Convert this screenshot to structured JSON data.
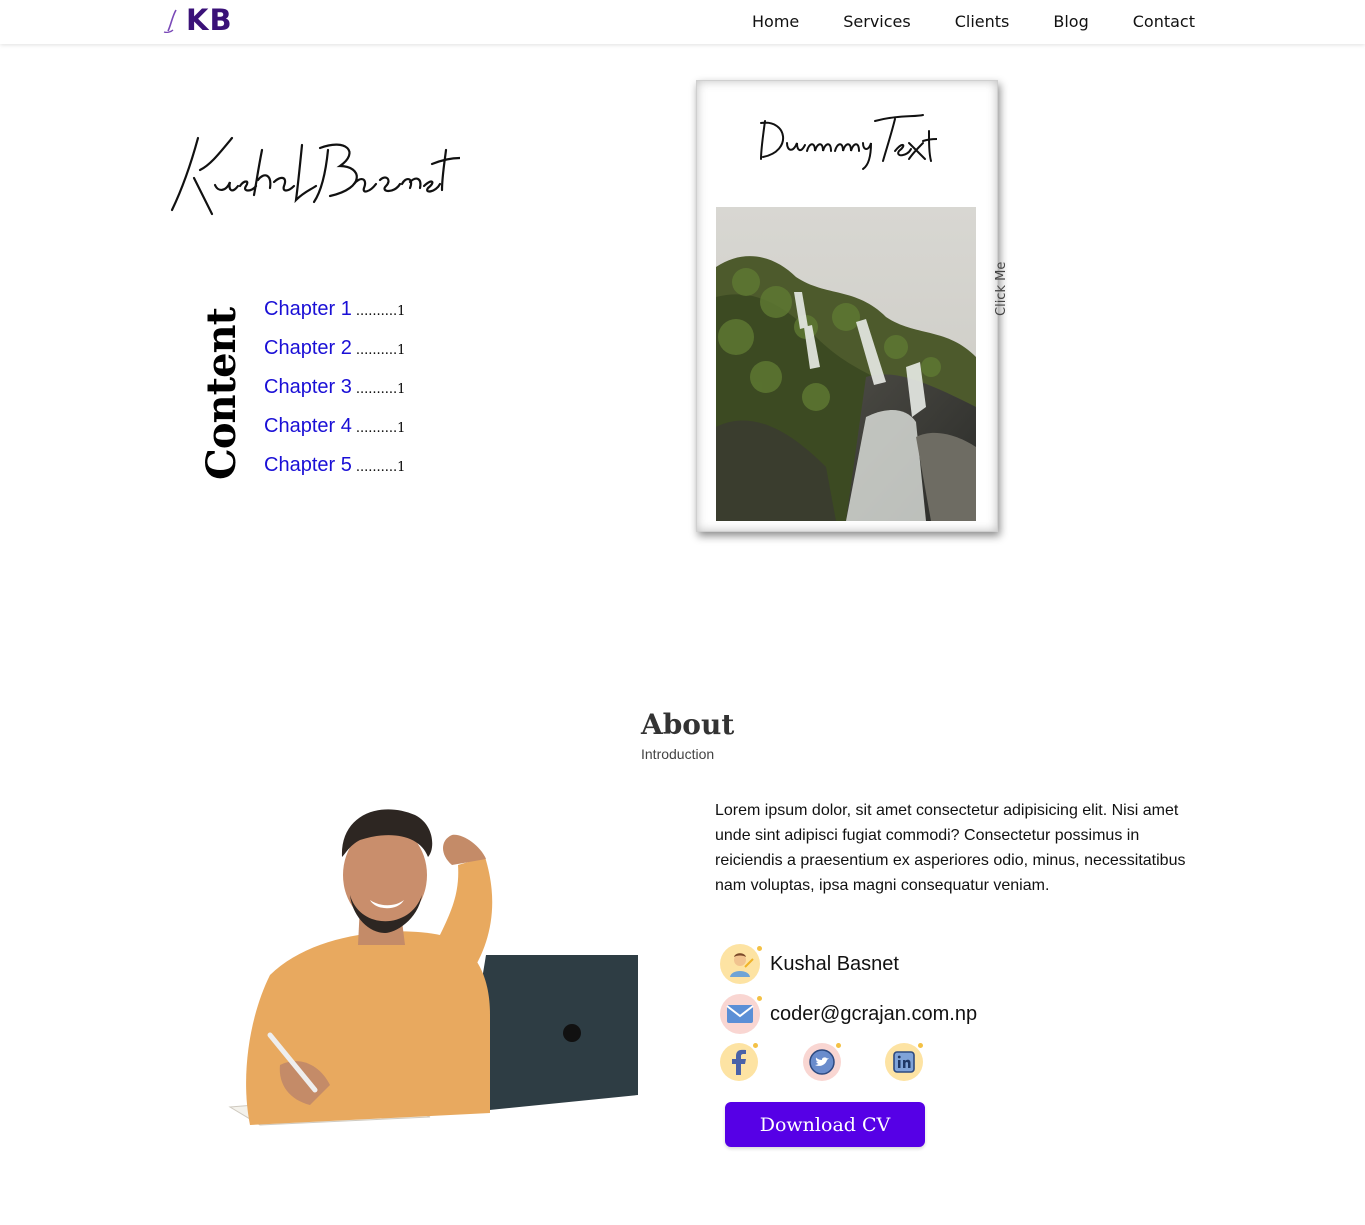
{
  "nav": {
    "logo_text": "KB",
    "links": [
      "Home",
      "Services",
      "Clients",
      "Blog",
      "Contact"
    ]
  },
  "hero": {
    "signature": "Kushal Basnet",
    "contents_title": "Content",
    "chapters": [
      {
        "label": "Chapter 1",
        "dots": "..........",
        "page": "1"
      },
      {
        "label": "Chapter 2",
        "dots": "..........",
        "page": "1"
      },
      {
        "label": "Chapter 3",
        "dots": "..........",
        "page": "1"
      },
      {
        "label": "Chapter 4",
        "dots": "..........",
        "page": "1"
      },
      {
        "label": "Chapter 5",
        "dots": "..........",
        "page": "1"
      }
    ]
  },
  "book": {
    "title": "Dummy Text",
    "side_label": "Click Me"
  },
  "about": {
    "title": "About",
    "subtitle": "Introduction",
    "description": "Lorem ipsum dolor, sit amet consectetur adipisicing elit. Nisi amet unde sint adipisci fugiat commodi? Consectetur possimus in reiciendis a praesentium ex asperiores odio, minus, necessitatibus nam voluptas, ipsa magni consequatur veniam.",
    "name": "Kushal Basnet",
    "email": "coder@gcrajan.com.np",
    "social_icons": [
      "facebook-icon",
      "twitter-icon",
      "linkedin-icon"
    ],
    "cv_button": "Download CV"
  },
  "colors": {
    "accent": "#5600e6",
    "link": "#1a0fd6",
    "logo": "#3a1178"
  }
}
